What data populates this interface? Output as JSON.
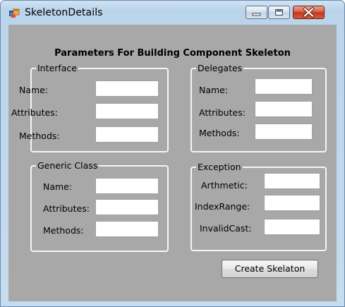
{
  "window": {
    "title": "SkeletonDetails",
    "icon": "winforms-form-icon",
    "controls": [
      "minimize-icon",
      "maximize-icon",
      "close-icon"
    ]
  },
  "heading": "Parameters For Building Component Skeleton",
  "groups": {
    "interface": {
      "legend": "Interface",
      "fields": [
        {
          "label": "Name:",
          "value": ""
        },
        {
          "label": "Attributes:",
          "value": ""
        },
        {
          "label": "Methods:",
          "value": ""
        }
      ]
    },
    "delegates": {
      "legend": "Delegates",
      "fields": [
        {
          "label": "Name:",
          "value": ""
        },
        {
          "label": "Attributes:",
          "value": ""
        },
        {
          "label": "Methods:",
          "value": ""
        }
      ]
    },
    "generic_class": {
      "legend": "Generic Class",
      "fields": [
        {
          "label": "Name:",
          "value": ""
        },
        {
          "label": "Attributes:",
          "value": ""
        },
        {
          "label": "Methods:",
          "value": ""
        }
      ]
    },
    "exception": {
      "legend": "Exception",
      "fields": [
        {
          "label": "Arthmetic:",
          "value": ""
        },
        {
          "label": "IndexRange:",
          "value": ""
        },
        {
          "label": "InvalidCast:",
          "value": ""
        }
      ]
    }
  },
  "create_button": "Create Skelaton",
  "colors": {
    "client_background": "#a8a8a8",
    "frame_top": "#cfe3f4",
    "frame": "#bcd5eb",
    "group_border": "#f5f5f5",
    "close_button": "#c2381e"
  }
}
